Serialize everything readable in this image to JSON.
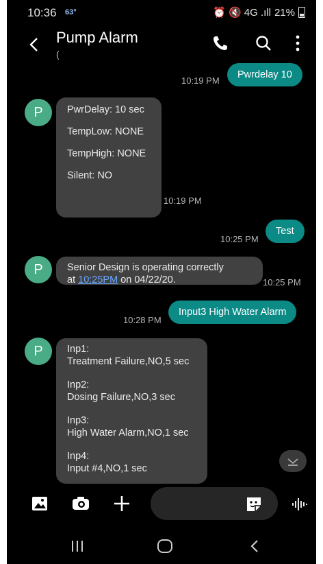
{
  "status_bar": {
    "time": "10:36",
    "temp": "63°",
    "signal_text": "⏰ 🔇 4G .ıll",
    "battery": "21%"
  },
  "header": {
    "title": "Pump Alarm",
    "subtitle": "("
  },
  "messages": [
    {
      "direction": "out",
      "text": "Pwrdelay 10",
      "time": "10:19 PM"
    },
    {
      "direction": "in",
      "avatar": "P",
      "lines": [
        "PwrDelay: 10 sec",
        "TempLow: NONE",
        "TempHigh: NONE",
        "Silent: NO"
      ],
      "time": "10:19 PM"
    },
    {
      "direction": "out",
      "text": "Test",
      "time": "10:25 PM"
    },
    {
      "direction": "in",
      "avatar": "P",
      "line1": "Senior Design is operating correctly",
      "line2_prefix": "at ",
      "link": "10:25PM",
      "line2_suffix": " on 04/22/20.",
      "time": "10:25 PM"
    },
    {
      "direction": "out",
      "text": "Input3 High Water Alarm",
      "time": "10:28 PM"
    },
    {
      "direction": "in",
      "avatar": "P",
      "blocks": [
        {
          "label": "Inp1:",
          "value": "Treatment Failure,NO,5 sec"
        },
        {
          "label": "Inp2:",
          "value": "Dosing Failure,NO,3 sec"
        },
        {
          "label": "Inp3:",
          "value": "High Water Alarm,NO,1 sec"
        },
        {
          "label": "Inp4:",
          "value": "Input #4,NO,1 sec"
        }
      ]
    }
  ],
  "composer": {
    "icons": [
      "gallery-icon",
      "camera-icon",
      "plus-icon",
      "sticker-icon",
      "voice-icon"
    ]
  },
  "colors": {
    "outgoing_bubble": "#0b8a86",
    "incoming_bubble": "#414141",
    "avatar": "#4aac87",
    "link": "#6aa7ff",
    "background": "#000000"
  }
}
